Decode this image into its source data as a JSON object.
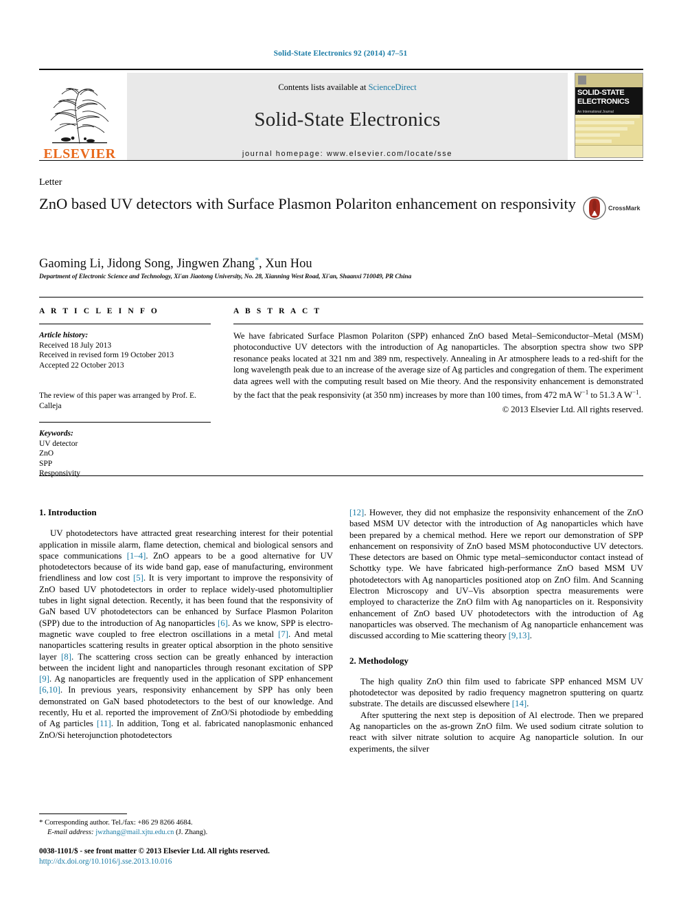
{
  "running_head": "Solid-State Electronics 92 (2014) 47–51",
  "masthead": {
    "contents_prefix": "Contents lists available at ",
    "sciencedirect": "ScienceDirect",
    "journal_title": "Solid-State Electronics",
    "homepage": "journal homepage: www.elsevier.com/locate/sse",
    "publisher": "ELSEVIER",
    "cover": {
      "line1": "SOLID-STATE",
      "line2": "ELECTRONICS",
      "subtitle": "An International Journal"
    }
  },
  "article": {
    "doctype": "Letter",
    "title": "ZnO based UV detectors with Surface Plasmon Polariton enhancement on responsivity",
    "crossmark_label": "CrossMark",
    "authors": "Gaoming Li, Jidong Song, Jingwen Zhang",
    "corresponding_marker": "*",
    "authors_tail": ", Xun Hou",
    "affiliation": "Department of Electronic Science and Technology, Xi'an Jiaotong University, No. 28, Xianning West Road, Xi'an, Shaanxi 710049, PR China"
  },
  "info": {
    "heading": "A R T I C L E    I N F O",
    "history_label": "Article history:",
    "history": [
      "Received 18 July 2013",
      "Received in revised form 19 October 2013",
      "Accepted 22 October 2013"
    ],
    "editor_note": "The review of this paper was arranged by Prof. E. Calleja",
    "keywords_label": "Keywords:",
    "keywords": [
      "UV detector",
      "ZnO",
      "SPP",
      "Responsivity"
    ]
  },
  "abstract": {
    "heading": "A B S T R A C T",
    "body": "We have fabricated Surface Plasmon Polariton (SPP) enhanced ZnO based Metal–Semiconductor–Metal (MSM) photoconductive UV detectors with the introduction of Ag nanoparticles. The absorption spectra show two SPP resonance peaks located at 321 nm and 389 nm, respectively. Annealing in Ar atmosphere leads to a red-shift for the long wavelength peak due to an increase of the average size of Ag particles and congregation of them. The experiment data agrees well with the computing result based on Mie theory. And the responsivity enhancement is demonstrated by the fact that the peak responsivity (at 350 nm) increases by more than 100 times, from 472 mA W",
    "unit_sup_1": "−1",
    "body_mid": " to 51.3 A W",
    "unit_sup_2": "−1",
    "body_end": ".",
    "copyright": "© 2013 Elsevier Ltd. All rights reserved."
  },
  "sections": {
    "intro_title": "1. Introduction",
    "intro_p1_a": "UV photodetectors have attracted great researching interest for their potential application in missile alarm, flame detection, chemical and biological sensors and space communications ",
    "ref_1_4": "[1–4]",
    "intro_p1_b": ". ZnO appears to be a good alternative for UV photodetectors because of its wide band gap, ease of manufacturing, environment friendliness and low cost ",
    "ref_5": "[5]",
    "intro_p1_c": ". It is very important to improve the responsivity of ZnO based UV photodetectors in order to replace widely-used photomultiplier tubes in light signal detection. Recently, it has been found that the responsivity of GaN based UV photodetectors can be enhanced by Surface Plasmon Polariton (SPP) due to the introduction of Ag nanoparticles ",
    "ref_6": "[6]",
    "intro_p1_d": ". As we know, SPP is electro-magnetic wave coupled to free electron oscillations in a metal ",
    "ref_7": "[7]",
    "intro_p1_e": ". And metal nanoparticles scattering results in greater optical absorption in the photo sensitive layer ",
    "ref_8": "[8]",
    "intro_p1_f": ". The scattering cross section can be greatly enhanced by interaction between the incident light and nanoparticles through resonant excitation of SPP ",
    "ref_9": "[9]",
    "intro_p1_g": ". Ag nanoparticles are frequently used in the application of SPP enhancement ",
    "ref_6_10": "[6,10]",
    "intro_p1_h": ". In previous years, responsivity enhancement by SPP has only been demonstrated on GaN based photodetectors to the best of our knowledge. And recently, Hu et al. reported the improvement of ZnO/Si photodiode by embedding of Ag particles ",
    "ref_11": "[11]",
    "intro_p1_i": ". In addition, Tong et al. fabricated nanoplasmonic enhanced ZnO/Si heterojunction photodetectors ",
    "ref_12": "[12]",
    "intro_p1_j": ". However, they did not emphasize the responsivity enhancement of the ZnO based MSM UV detector with the introduction of Ag nanoparticles which have been prepared by a chemical method. Here we report our demonstration of SPP enhancement on responsivity of ZnO based MSM photoconductive UV detectors. These detectors are based on Ohmic type metal–semiconductor contact instead of Schottky type. We have fabricated high-performance ZnO based MSM UV photodetectors with Ag nanoparticles positioned atop on ZnO film. And Scanning Electron Microscopy and UV–Vis absorption spectra measurements were employed to characterize the ZnO film with Ag nanoparticles on it. Responsivity enhancement of ZnO based UV photodetectors with the introduction of Ag nanoparticles was observed. The mechanism of Ag nanoparticle enhancement was discussed according to Mie scattering theory ",
    "ref_9_13": "[9,13]",
    "intro_p1_k": ".",
    "method_title": "2. Methodology",
    "method_p1_a": "The high quality ZnO thin film used to fabricate SPP enhanced MSM UV photodetector was deposited by radio frequency magnetron sputtering on quartz substrate. The details are discussed elsewhere ",
    "ref_14": "[14]",
    "method_p1_b": ".",
    "method_p2": "After sputtering the next step is deposition of Al electrode. Then we prepared Ag nanoparticles on the as-grown ZnO film. We used sodium citrate solution to react with silver nitrate solution to acquire Ag nanoparticle solution. In our experiments, the silver"
  },
  "footer": {
    "star": "*",
    "corresponding": "Corresponding author. Tel./fax: +86 29 8266 4684.",
    "email_label": "E-mail address:",
    "email": "jwzhang@mail.xjtu.edu.cn",
    "email_suffix": "(J. Zhang).",
    "issn": "0038-1101/$ - see front matter © 2013 Elsevier Ltd. All rights reserved.",
    "doi": "http://dx.doi.org/10.1016/j.sse.2013.10.016"
  },
  "colors": {
    "link": "#1a7ba5",
    "elsevier_orange": "#E8681B"
  }
}
